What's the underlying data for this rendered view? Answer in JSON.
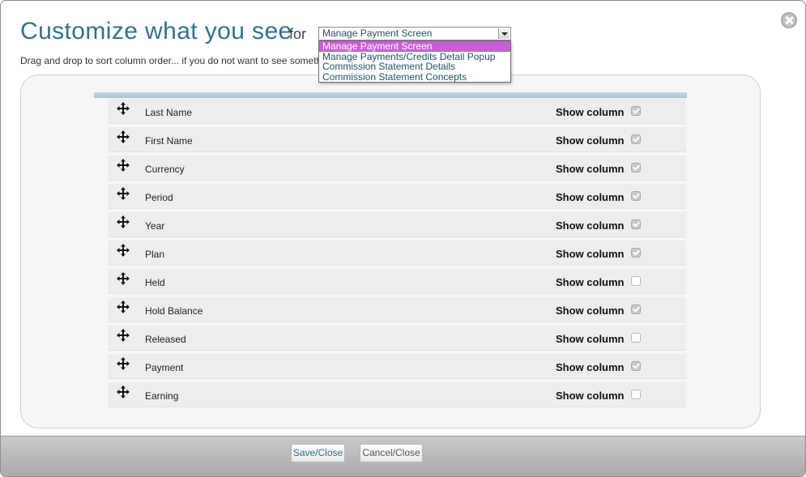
{
  "header": {
    "title": "Customize what you see",
    "for_label": "for",
    "subtitle": "Drag and drop to sort column order... if you do not want to see someth"
  },
  "screen_select": {
    "value": "Manage Payment Screen",
    "options": [
      "Manage Payment Screen",
      "Manage Payments/Credits Detail Popup",
      "Commission Statement Details",
      "Commission Statement Concepts"
    ]
  },
  "columns": [
    {
      "name": "Last Name",
      "show_label": "Show column",
      "checked": true
    },
    {
      "name": "First Name",
      "show_label": "Show column",
      "checked": true
    },
    {
      "name": "Currency",
      "show_label": "Show column",
      "checked": true
    },
    {
      "name": "Period",
      "show_label": "Show column",
      "checked": true
    },
    {
      "name": "Year",
      "show_label": "Show column",
      "checked": true
    },
    {
      "name": "Plan",
      "show_label": "Show column",
      "checked": true
    },
    {
      "name": "Held",
      "show_label": "Show column",
      "checked": false
    },
    {
      "name": "Hold Balance",
      "show_label": "Show column",
      "checked": true
    },
    {
      "name": "Released",
      "show_label": "Show column",
      "checked": false
    },
    {
      "name": "Payment",
      "show_label": "Show column",
      "checked": true
    },
    {
      "name": "Earning",
      "show_label": "Show column",
      "checked": false
    }
  ],
  "footer": {
    "save_label": "Save/Close",
    "cancel_label": "Cancel/Close"
  },
  "icons": {
    "close": "close-circle-icon",
    "move": "move-arrows-icon",
    "dropdown_arrow": "chevron-down-icon"
  },
  "colors": {
    "title": "#2f7290",
    "selected_option": "#c95fd6",
    "header_bar": "#b4ccd9"
  }
}
